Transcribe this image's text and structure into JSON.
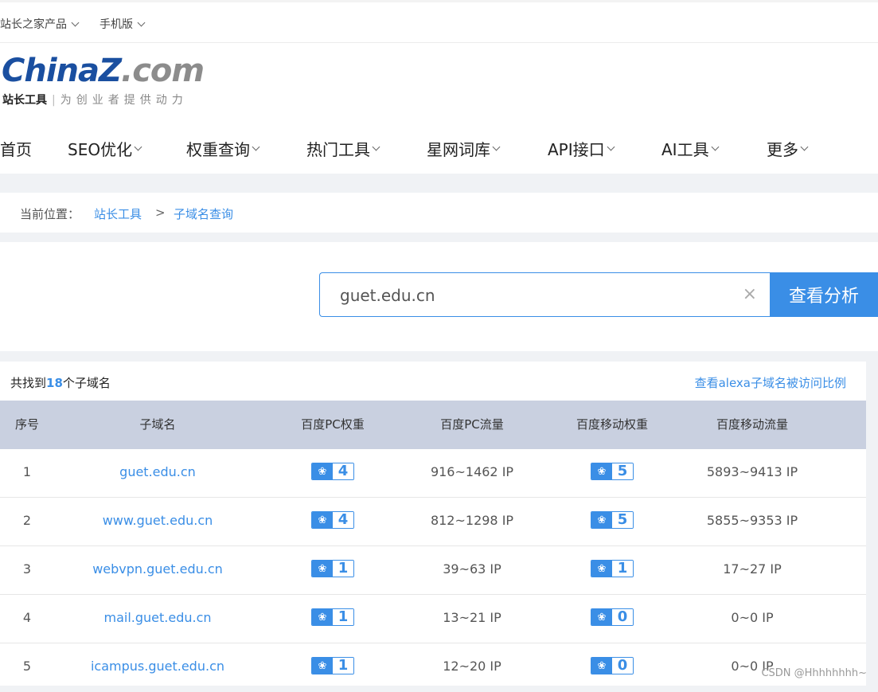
{
  "topbar": {
    "products": "站长之家产品",
    "mobile": "手机版"
  },
  "logo": {
    "brand_main": "ChinaZ",
    "brand_suffix": ".com",
    "slogan_main": "站长工具",
    "slogan_sep": "|",
    "slogan_sub": "为创业者提供动力"
  },
  "nav": {
    "items": [
      {
        "label": "首页"
      },
      {
        "label": "SEO优化"
      },
      {
        "label": "权重查询"
      },
      {
        "label": "热门工具"
      },
      {
        "label": "星网词库"
      },
      {
        "label": "API接口"
      },
      {
        "label": "AI工具"
      },
      {
        "label": "更多"
      }
    ]
  },
  "breadcrumb": {
    "prefix": "当前位置：",
    "level1": "站长工具",
    "separator": ">",
    "level2": "子域名查询"
  },
  "search": {
    "value": "guet.edu.cn",
    "clear_glyph": "×",
    "button": "查看分析"
  },
  "results": {
    "prefix": "共找到",
    "count": "18",
    "suffix": "个子域名",
    "alexa_link": "查看alexa子域名被访问比例",
    "columns": [
      "序号",
      "子域名",
      "百度PC权重",
      "百度PC流量",
      "百度移动权重",
      "百度移动流量"
    ],
    "rows": [
      {
        "no": "1",
        "domain": "guet.edu.cn",
        "pc_weight": "4",
        "pc_traffic": "916~1462 IP",
        "m_weight": "5",
        "m_traffic": "5893~9413 IP"
      },
      {
        "no": "2",
        "domain": "www.guet.edu.cn",
        "pc_weight": "4",
        "pc_traffic": "812~1298 IP",
        "m_weight": "5",
        "m_traffic": "5855~9353 IP"
      },
      {
        "no": "3",
        "domain": "webvpn.guet.edu.cn",
        "pc_weight": "1",
        "pc_traffic": "39~63 IP",
        "m_weight": "1",
        "m_traffic": "17~27 IP"
      },
      {
        "no": "4",
        "domain": "mail.guet.edu.cn",
        "pc_weight": "1",
        "pc_traffic": "13~21 IP",
        "m_weight": "0",
        "m_traffic": "0~0 IP"
      },
      {
        "no": "5",
        "domain": "icampus.guet.edu.cn",
        "pc_weight": "1",
        "pc_traffic": "12~20 IP",
        "m_weight": "0",
        "m_traffic": "0~0 IP"
      }
    ]
  },
  "watermark": "CSDN @Hhhhhhhh~",
  "colors": {
    "accent": "#3a8ee6",
    "brand_blue": "#1a4fa0",
    "table_header": "#c9d0e0",
    "page_bg": "#f0f2f5"
  },
  "icons": {
    "badge_icon": "baidu-paw-icon",
    "dropdown_icon": "chevron-down-icon",
    "clear_icon": "close-icon"
  }
}
